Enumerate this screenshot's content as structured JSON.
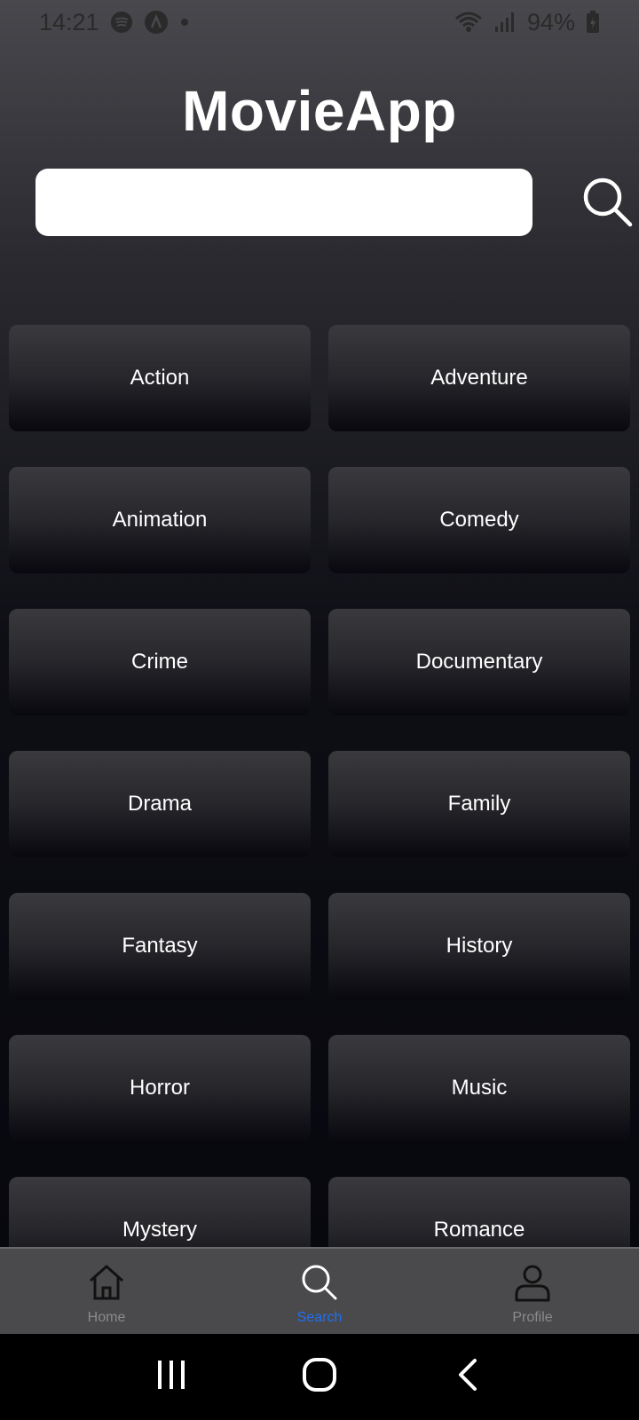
{
  "status_bar": {
    "time": "14:21",
    "battery": "94%",
    "icons": [
      "spotify-icon",
      "a-icon",
      "dot-icon",
      "wifi-icon",
      "signal-icon",
      "battery-icon"
    ]
  },
  "app": {
    "title": "MovieApp"
  },
  "search": {
    "value": "",
    "placeholder": "",
    "icon": "search-icon"
  },
  "genres": [
    "Action",
    "Adventure",
    "Animation",
    "Comedy",
    "Crime",
    "Documentary",
    "Drama",
    "Family",
    "Fantasy",
    "History",
    "Horror",
    "Music",
    "Mystery",
    "Romance"
  ],
  "bottom_nav": {
    "items": [
      {
        "label": "Home",
        "icon": "home-icon",
        "active": false
      },
      {
        "label": "Search",
        "icon": "search-icon",
        "active": true
      },
      {
        "label": "Profile",
        "icon": "person-icon",
        "active": false
      }
    ],
    "active_color": "#1f6ff0"
  },
  "system_nav": {
    "icons": [
      "recents-icon",
      "home-circle-icon",
      "back-icon"
    ]
  }
}
